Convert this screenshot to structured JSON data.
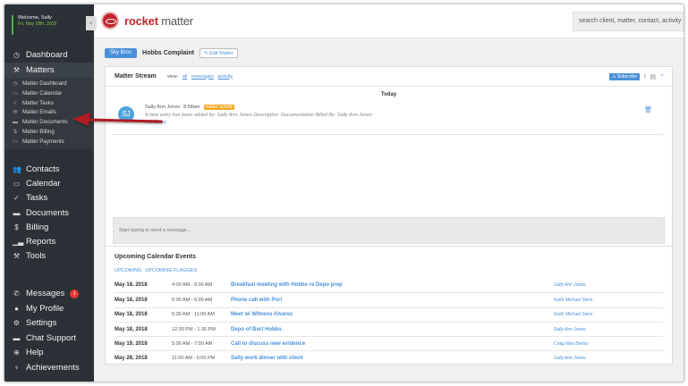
{
  "sidebar": {
    "welcome_line1": "Welcome, Sally",
    "welcome_line2": "Fri, May 18th, 2018",
    "collapse_icon": "chevron-left",
    "dashboard": "Dashboard",
    "matters": "Matters",
    "matters_sub": [
      {
        "label": "Matter Dashboard",
        "icon": "clock"
      },
      {
        "label": "Matter Calendar",
        "icon": "calendar"
      },
      {
        "label": "Matter Tasks",
        "icon": "check"
      },
      {
        "label": "Matter Emails",
        "icon": "envelope"
      },
      {
        "label": "Matter Documents",
        "icon": "folder"
      },
      {
        "label": "Matter Billing",
        "icon": "dollar"
      },
      {
        "label": "Matter Payments",
        "icon": "card"
      }
    ],
    "lower": [
      {
        "label": "Contacts",
        "icon": "people"
      },
      {
        "label": "Calendar",
        "icon": "calendar"
      },
      {
        "label": "Tasks",
        "icon": "check"
      },
      {
        "label": "Documents",
        "icon": "folder"
      },
      {
        "label": "Billing",
        "icon": "dollar"
      },
      {
        "label": "Reports",
        "icon": "chart"
      },
      {
        "label": "Tools",
        "icon": "wrench"
      }
    ],
    "bottom": [
      {
        "label": "Messages",
        "icon": "phone",
        "badge": "1"
      },
      {
        "label": "My Profile",
        "icon": "user"
      },
      {
        "label": "Settings",
        "icon": "gear"
      },
      {
        "label": "Chat Support",
        "icon": "chat"
      },
      {
        "label": "Help",
        "icon": "lifebuoy"
      },
      {
        "label": "Achievements",
        "icon": "trophy"
      }
    ]
  },
  "topbar": {
    "logo_rocket": "rocket",
    "logo_matter": "matter",
    "search_placeholder": "search client, matter, contact, activity"
  },
  "breadcrumb": {
    "client": "Sky Bros",
    "matter": "Hobbs Complaint",
    "edit_label": "Edit Matter"
  },
  "stream": {
    "title": "Matter Stream",
    "view_label": "view:",
    "filters": [
      "all",
      "messages",
      "activity"
    ],
    "subscribe_label": "Subscribe",
    "today_label": "Today",
    "entry": {
      "initials": "SJ",
      "author": "Sally Ann Jones",
      "time": "8:58am",
      "tag": "matter activity",
      "description": "A time entry has been added by: Sally Ann Jones Description: Documentation Billed By: Sally Ann Jones",
      "edit_label": "Edit Entry"
    },
    "message_placeholder": "Start typing to send a message..."
  },
  "events": {
    "title": "Upcoming Calendar Events",
    "tabs": [
      "UPCOMING",
      "UPCOMING FLAGGED"
    ],
    "rows": [
      {
        "date": "May 18, 2018",
        "time": "4:00 AM - 6:00 AM",
        "title": "Breakfast meeting with Hobbs re Depo prep",
        "person": "Sally Ann Jones"
      },
      {
        "date": "May 18, 2018",
        "time": "5:00 AM - 6:00 AM",
        "title": "Phone call with Port",
        "person": "Keith Michael Stern"
      },
      {
        "date": "May 18, 2018",
        "time": "5:30 AM - 11:00 AM",
        "title": "Meet w/ Witness Alvarez",
        "person": "Keith Michael Stern"
      },
      {
        "date": "May 18, 2018",
        "time": "12:30 PM - 1:30 PM",
        "title": "Depo of Burt Hobbs",
        "person": "Sally Ann Jones"
      },
      {
        "date": "May 19, 2018",
        "time": "5:00 AM - 7:00 AM",
        "title": "Call to discuss new evidence",
        "person": "Craig Max Bierko"
      },
      {
        "date": "May 28, 2018",
        "time": "11:00 AM - 5:00 PM",
        "title": "Sally work dinner with client",
        "person": "Sally Ann Jones"
      }
    ]
  },
  "colors": {
    "accent": "#4a90d9",
    "brand": "#c0272d",
    "sidebar": "#2b3137",
    "arrow": "#b01e23"
  }
}
